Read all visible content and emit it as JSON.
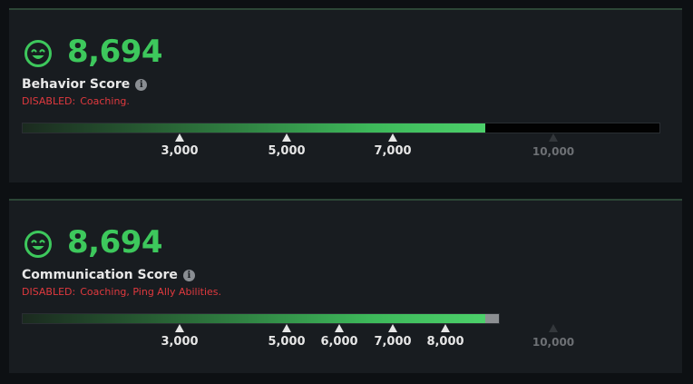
{
  "colors": {
    "score_green": "#3dc85c",
    "disabled_red": "#e0393e",
    "panel_bg": "#181c20",
    "page_bg": "#0d1013"
  },
  "panels": [
    {
      "icon": "smiley-icon",
      "score": "8,694",
      "title": "Behavior Score",
      "disabled_label": "DISABLED:",
      "disabled_text": "Coaching.",
      "bar": {
        "min": 0,
        "max": 12000,
        "fill_value": 8694,
        "over_value": null
      },
      "ticks": [
        "3,000",
        "5,000",
        "7,000"
      ],
      "max_tick": "10,000"
    },
    {
      "icon": "smiley-icon",
      "score": "8,694",
      "title": "Communication Score",
      "disabled_label": "DISABLED:",
      "disabled_text": "Coaching, Ping Ally Abilities.",
      "bar": {
        "min": 0,
        "max": 10000,
        "fill_value": 8694,
        "over_value": 9000
      },
      "ticks": [
        "3,000",
        "5,000",
        "6,000",
        "7,000",
        "8,000"
      ],
      "max_tick": "10,000"
    }
  ]
}
